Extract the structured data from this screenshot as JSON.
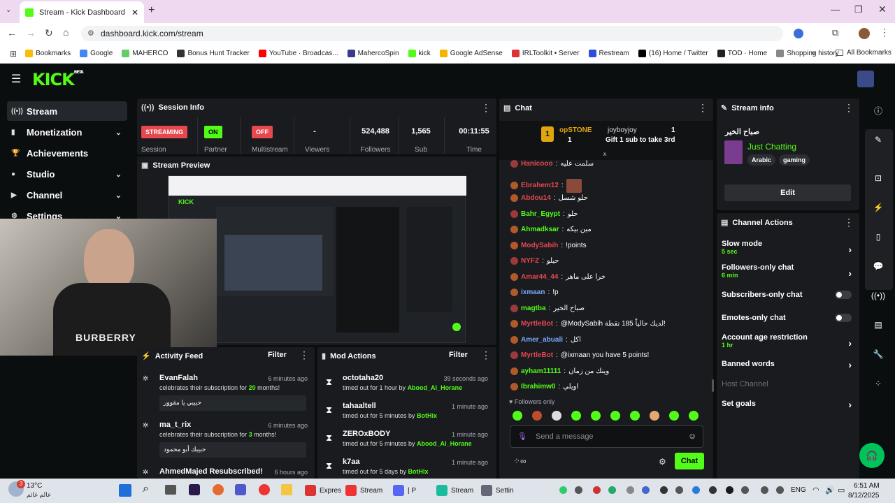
{
  "browser": {
    "tab_title": "Stream - Kick Dashboard",
    "url": "dashboard.kick.com/stream",
    "bookmarks": [
      "Bookmarks",
      "Google",
      "MAHERCO",
      "Bonus Hunt Tracker",
      "YouTube · Broadcas...",
      "MahercoSpin",
      "kick",
      "Google AdSense",
      "IRLToolkit • Server",
      "Restream",
      "(16) Home / Twitter",
      "TOD · Home",
      "Shopping history"
    ],
    "all_bookmarks": "All Bookmarks"
  },
  "kick": {
    "logo": "KICK",
    "beta": "BETA",
    "sidebar": [
      {
        "label": "Stream"
      },
      {
        "label": "Monetization"
      },
      {
        "label": "Achievements"
      },
      {
        "label": "Studio"
      },
      {
        "label": "Channel"
      },
      {
        "label": "Settings"
      }
    ],
    "session": {
      "title": "Session Info",
      "stats": [
        {
          "value": "STREAMING",
          "label": "Session"
        },
        {
          "value": "ON",
          "label": "Partner"
        },
        {
          "value": "OFF",
          "label": "Multistream"
        },
        {
          "value": "-",
          "label": "Viewers"
        },
        {
          "value": "524,488",
          "label": "Followers"
        },
        {
          "value": "1,565",
          "label": "Sub"
        },
        {
          "value": "00:11:55",
          "label": "Time"
        }
      ]
    },
    "preview": {
      "title": "Stream Preview"
    },
    "activity": {
      "title": "Activity Feed",
      "filter": "Filter",
      "items": [
        {
          "name": "EvanFalah",
          "time": "6 minutes ago",
          "pre": "celebrates their subscription for ",
          "count": "20",
          "post": " months!",
          "msg": "حبيبي يا مقوور"
        },
        {
          "name": "ma_t_rix",
          "time": "6 minutes ago",
          "pre": "celebrates their subscription for ",
          "count": "3",
          "post": " months!",
          "msg": "حبيبك أبو محمود"
        },
        {
          "name": "AhmedMajed Resubscribed!",
          "time": "6 hours ago",
          "pre": "",
          "count": "",
          "post": "",
          "msg": ""
        }
      ]
    },
    "mod": {
      "title": "Mod Actions",
      "filter": "Filter",
      "items": [
        {
          "name": "octotaha20",
          "time": "39 seconds ago",
          "desc": "timed out for 1 hour by ",
          "by": "Abood_Al_Horane"
        },
        {
          "name": "tahaaltell",
          "time": "1 minute ago",
          "desc": "timed out for 5 minutes by ",
          "by": "BotHix"
        },
        {
          "name": "ZEROxBODY",
          "time": "1 minute ago",
          "desc": "timed out for 5 minutes by ",
          "by": "Abood_Al_Horane"
        },
        {
          "name": "k7aa",
          "time": "1 minute ago",
          "desc": "timed out for 5 days by ",
          "by": "BotHix"
        }
      ]
    },
    "chat": {
      "title": "Chat",
      "pinned": {
        "user1": "opSTONE",
        "count1": "1",
        "user2": "joyboyjoy",
        "count2": "1",
        "gift": "Gift 1 sub to take 3rd",
        "rank": "1"
      },
      "messages": [
        {
          "user": "Hanicooo",
          "text": "سلمت عليه",
          "color": "#e5484d"
        },
        {
          "user": "Ebrahem12",
          "text": "",
          "color": "#e5484d"
        },
        {
          "user": "Abdou14",
          "text": "حلو شسل",
          "color": "#e5484d"
        },
        {
          "user": "Bahr_Egypt",
          "text": "حلو",
          "color": "#53fc18"
        },
        {
          "user": "Ahmadksar",
          "text": "مين بيكه",
          "color": "#53fc18"
        },
        {
          "user": "ModySabih",
          "text": "!points",
          "color": "#e5484d"
        },
        {
          "user": "NYFZ",
          "text": "حيلو",
          "color": "#e5484d"
        },
        {
          "user": "Amar44_44",
          "text": "خرا على ماهر",
          "color": "#e5484d"
        },
        {
          "user": "ixmaan",
          "text": "!p",
          "color": "#7aa7ff"
        },
        {
          "user": "magtba",
          "text": "صباح الخير",
          "color": "#53fc18"
        },
        {
          "user": "MyrtleBot",
          "text": "@ModySabih لديك حالياً 185 نقطة!",
          "color": "#e5484d"
        },
        {
          "user": "Amer_abuali",
          "text": "اكل",
          "color": "#7aa7ff"
        },
        {
          "user": "MyrtleBot",
          "text": "@ixmaan you have 5 points!",
          "color": "#e5484d"
        },
        {
          "user": "ayham11111",
          "text": "وينك من زمان",
          "color": "#53fc18"
        },
        {
          "user": "Ibrahimw0",
          "text": "اويلي",
          "color": "#53fc18"
        }
      ],
      "followers_only": "Followers only",
      "placeholder": "Send a message",
      "send": "Chat"
    },
    "streaminfo": {
      "title": "Stream info",
      "stream_title": "صباح الخير",
      "category": "Just Chatting",
      "tags": [
        "Arabic",
        "gaming"
      ],
      "edit": "Edit"
    },
    "actions": {
      "title": "Channel Actions",
      "items": [
        {
          "label": "Slow mode",
          "sub": "5 sec",
          "type": "chevron"
        },
        {
          "label": "Followers-only chat",
          "sub": "6 min",
          "type": "chevron"
        },
        {
          "label": "Subscribers-only chat",
          "sub": "",
          "type": "toggle"
        },
        {
          "label": "Emotes-only chat",
          "sub": "",
          "type": "toggle"
        },
        {
          "label": "Account age restriction",
          "sub": "1 hr",
          "type": "chevron"
        },
        {
          "label": "Banned words",
          "sub": "",
          "type": "chevron"
        },
        {
          "label": "Host Channel",
          "sub": "",
          "type": "disabled"
        },
        {
          "label": "Set goals",
          "sub": "",
          "type": "chevron"
        }
      ]
    }
  },
  "webcam": {
    "shirt_text": "BURBERRY"
  },
  "taskbar": {
    "temp": "13°C",
    "weather": "عالم غائم",
    "notif": "3",
    "items": [
      "Expres",
      "Stream",
      "| P",
      "Stream",
      "Settin"
    ],
    "lang": "ENG",
    "time": "6:51 AM",
    "date": "8/12/2025"
  }
}
